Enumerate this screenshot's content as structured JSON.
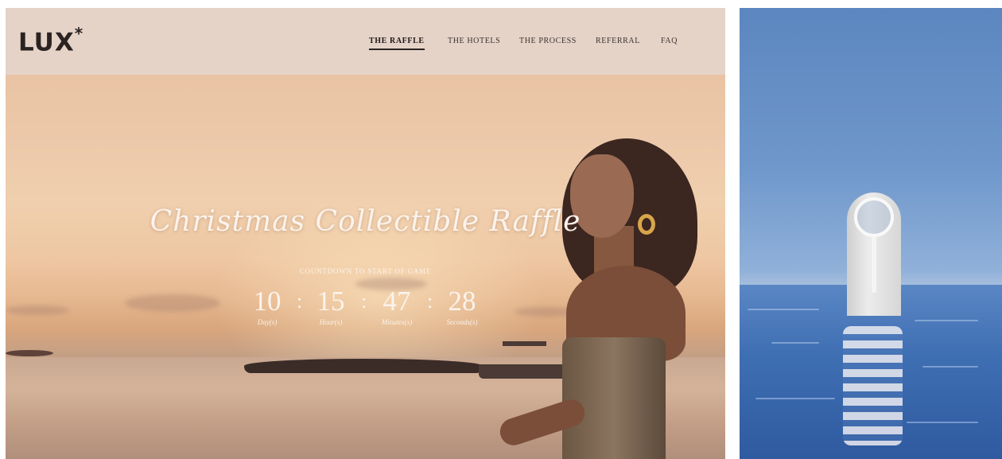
{
  "brand": {
    "logo": "LUX",
    "logo_mark": "*"
  },
  "nav": {
    "items": [
      {
        "label": "THE RAFFLE",
        "active": true
      },
      {
        "label": "THE HOTELS",
        "active": false
      },
      {
        "label": "THE PROCESS",
        "active": false
      },
      {
        "label": "REFERRAL",
        "active": false
      },
      {
        "label": "FAQ",
        "active": false
      }
    ]
  },
  "hero": {
    "title": "Christmas Collectible Raffle",
    "countdown_label": "COUNTDOWN TO START OF GAME",
    "countdown": {
      "days": "10",
      "days_caption": "Day(s)",
      "hours": "15",
      "hours_caption": "Hour(s)",
      "minutes": "47",
      "minutes_caption": "Minutes(s)",
      "seconds": "28",
      "seconds_caption": "Seconds(s)",
      "separator": ":"
    }
  },
  "colors": {
    "header_bg": "#e5d3c8",
    "text_dark": "#2a2321",
    "hero_text": "#fbf3ec",
    "sky_blue": "#6f97cb",
    "sea_blue": "#3f6fb3"
  },
  "icons": {
    "logo": "lux-logo",
    "side_image": "collectible-tag-in-sea"
  }
}
